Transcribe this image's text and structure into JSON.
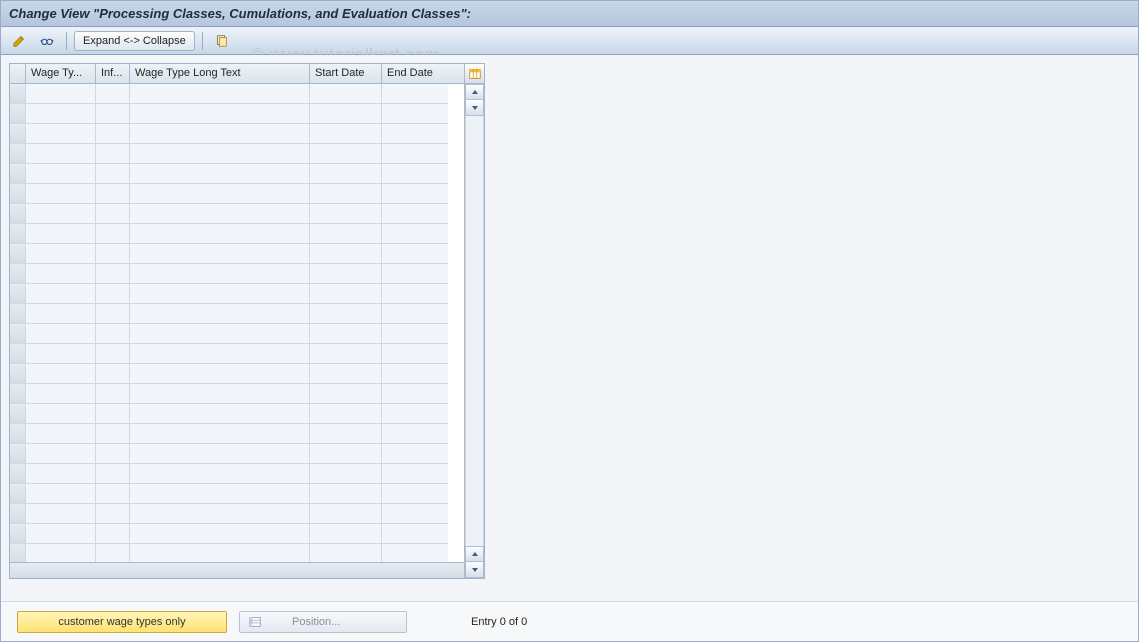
{
  "title": "Change View \"Processing Classes, Cumulations, and Evaluation Classes\":",
  "toolbar": {
    "pencil": "edit-icon",
    "glasses": "display-icon",
    "expand_collapse": "Expand <-> Collapse",
    "copy": "copy-icon"
  },
  "watermark": "© www.tutorialkart.com",
  "columns": {
    "wage_type": "Wage Ty...",
    "inf": "Inf...",
    "long_text": "Wage Type Long Text",
    "start_date": "Start Date",
    "end_date": "End Date"
  },
  "rows": [
    {},
    {},
    {},
    {},
    {},
    {},
    {},
    {},
    {},
    {},
    {},
    {},
    {},
    {},
    {},
    {},
    {},
    {},
    {},
    {},
    {},
    {},
    {},
    {}
  ],
  "footer": {
    "customer_wt": "customer wage types only",
    "position": "Position...",
    "entry": "Entry 0 of 0"
  }
}
